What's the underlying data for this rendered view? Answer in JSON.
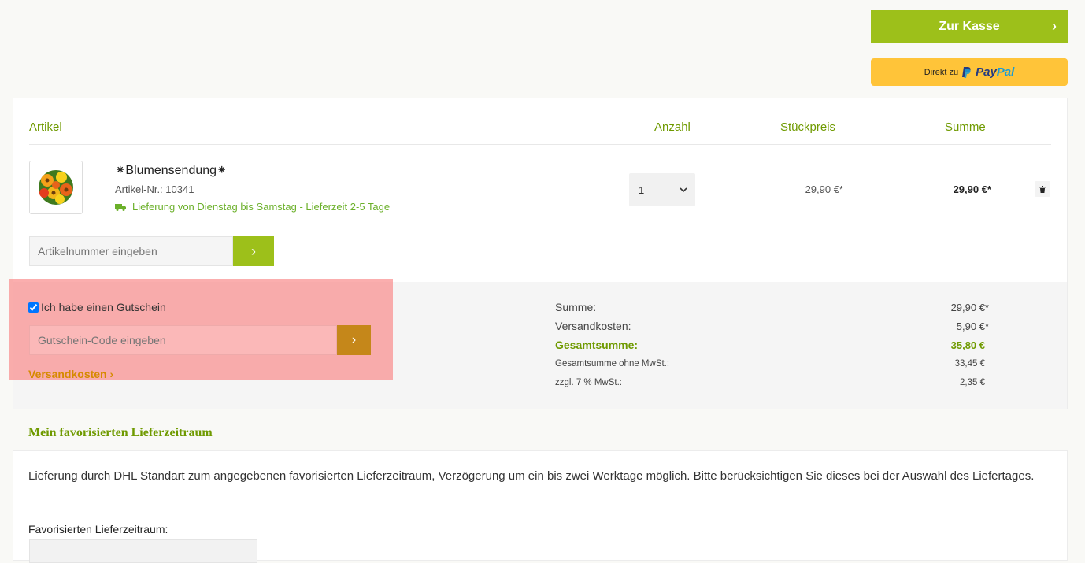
{
  "checkout_button": {
    "label": "Zur Kasse",
    "chevron": "›"
  },
  "paypal_button": {
    "prefix": "Direkt zu",
    "brand_part1": "Pay",
    "brand_part2": "Pal",
    "icon": "paypal-icon"
  },
  "cart": {
    "headers": {
      "article": "Artikel",
      "quantity": "Anzahl",
      "unit_price": "Stückpreis",
      "sum": "Summe"
    },
    "items": [
      {
        "name": "⁕Blumensendung⁕",
        "article_number": "Artikel-Nr.: 10341",
        "delivery": "Lieferung von Dienstag bis Samstag - Lieferzeit 2-5 Tage",
        "quantity": "1",
        "unit_price": "29,90 €*",
        "total": "29,90 €*"
      }
    ],
    "article_input_placeholder": "Artikelnummer eingeben",
    "article_input_button": "›"
  },
  "voucher": {
    "checkbox_label": "Ich habe einen Gutschein",
    "checked": true,
    "input_placeholder": "Gutschein-Code eingeben",
    "button": "›",
    "shipping_link": "Versandkosten ›"
  },
  "summary": {
    "sum_label": "Summe:",
    "sum_value": "29,90 €*",
    "shipping_label": "Versandkosten:",
    "shipping_value": "5,90 €*",
    "total_label": "Gesamtsumme:",
    "total_value": "35,80 €",
    "net_label": "Gesamtsumme ohne MwSt.:",
    "net_value": "33,45 €",
    "vat_label": "zzgl. 7 % MwSt.:",
    "vat_value": "2,35 €"
  },
  "delivery_section": {
    "title": "Mein favorisierten Lieferzeitraum",
    "text": "Lieferung durch DHL Standart zum angegebenen favorisierten Lieferzeitraum, Verzögerung um ein bis zwei Werktage möglich. Bitte berücksichtigen Sie dieses bei der Auswahl des Liefertages.",
    "field_label": "Favorisierten Lieferzeitraum:"
  },
  "colors": {
    "accent_green": "#9dc01a",
    "heading_green": "#6f9a00",
    "paypal_yellow": "#ffc439",
    "voucher_button": "#c5871a",
    "highlight": "#fa8c8c"
  }
}
